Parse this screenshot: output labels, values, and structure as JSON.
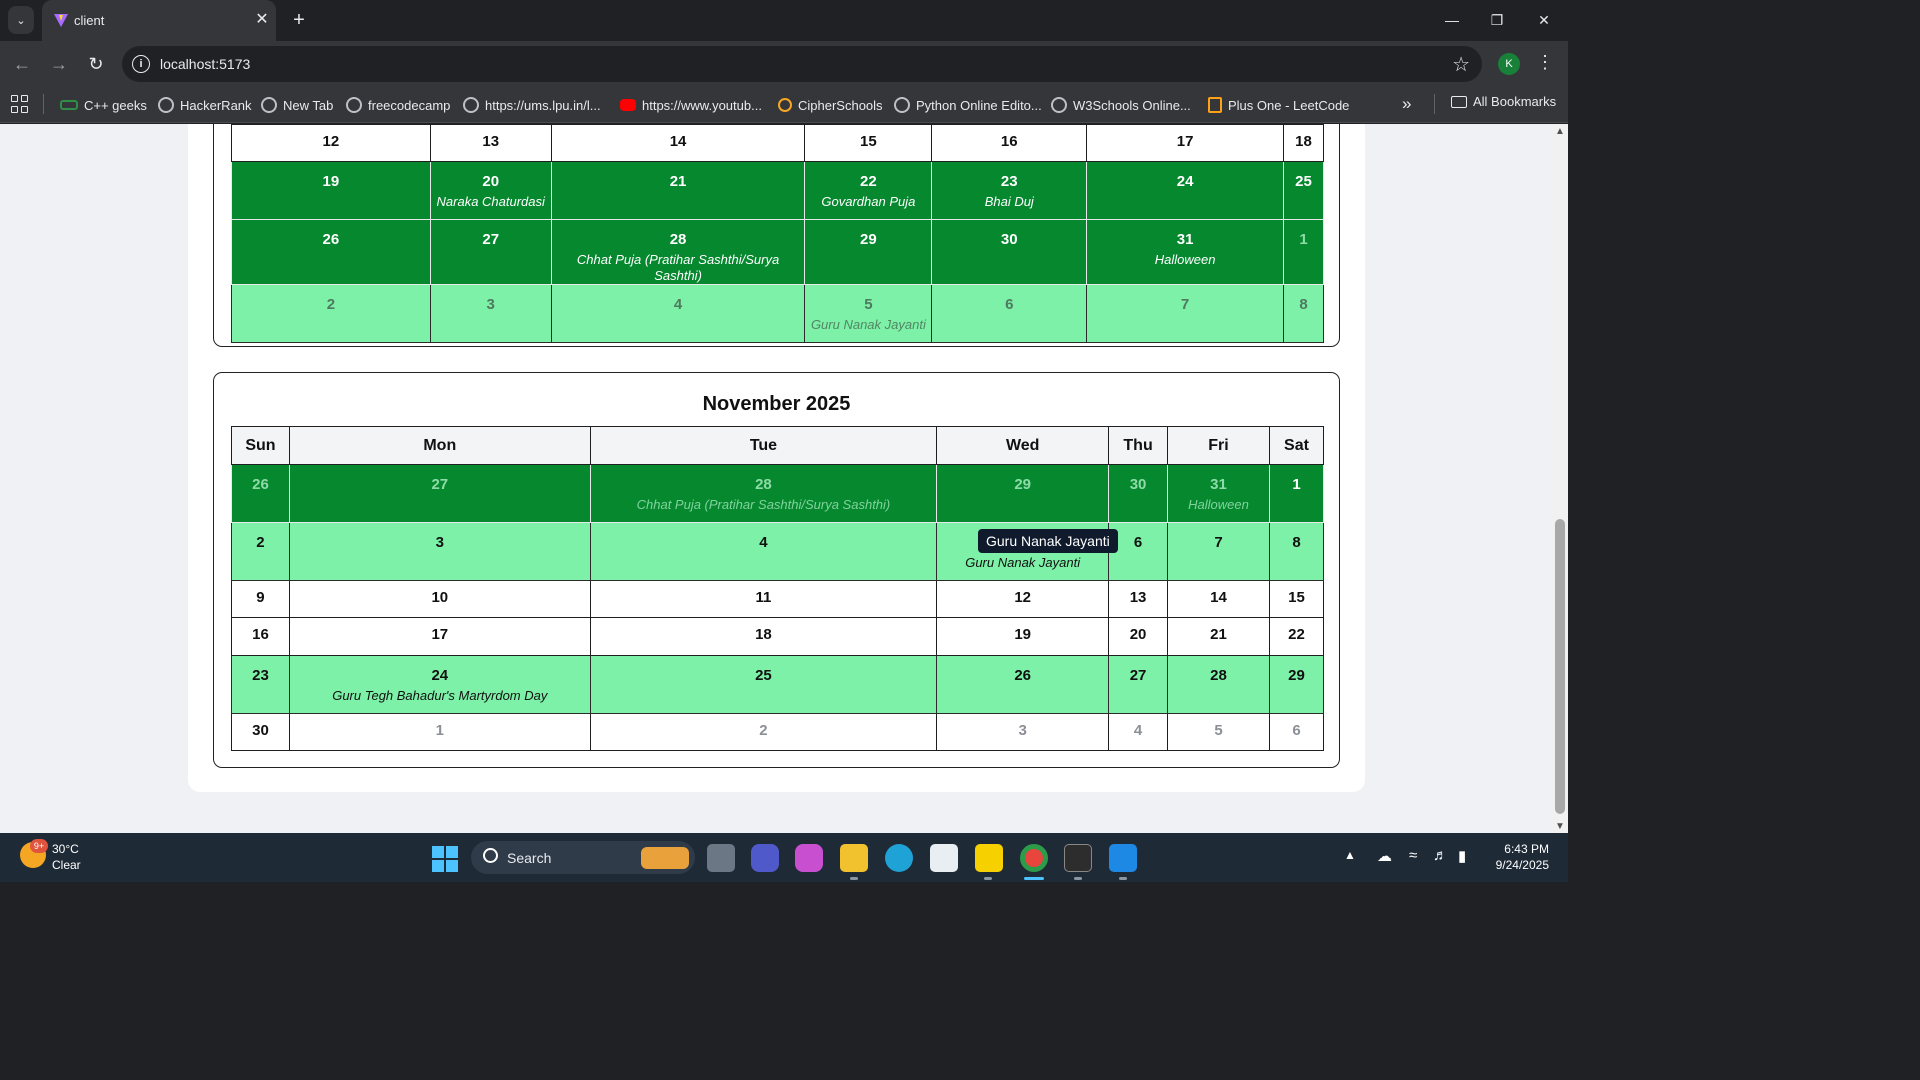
{
  "browser": {
    "tab_title": "client",
    "url": "localhost:5173",
    "profile_initial": "K",
    "bookmarks": [
      "C++ geeks",
      "HackerRank",
      "New Tab",
      "freecodecamp",
      "https://ums.lpu.in/l...",
      "https://www.youtub...",
      "CipherSchools",
      "Python Online Edito...",
      "W3Schools Online...",
      "Plus One - LeetCode"
    ],
    "all_bookmarks_label": "All Bookmarks"
  },
  "weekday_headers": [
    "Sun",
    "Mon",
    "Tue",
    "Wed",
    "Thu",
    "Fri",
    "Sat"
  ],
  "october": {
    "rows": [
      {
        "style": "white",
        "cells": [
          {
            "day": "12"
          },
          {
            "day": "13"
          },
          {
            "day": "14"
          },
          {
            "day": "15"
          },
          {
            "day": "16"
          },
          {
            "day": "17"
          },
          {
            "day": "18"
          }
        ]
      },
      {
        "style": "dark",
        "cells": [
          {
            "day": "19"
          },
          {
            "day": "20",
            "holiday": "Naraka Chaturdasi"
          },
          {
            "day": "21"
          },
          {
            "day": "22",
            "holiday": "Govardhan Puja"
          },
          {
            "day": "23",
            "holiday": "Bhai Duj"
          },
          {
            "day": "24"
          },
          {
            "day": "25"
          }
        ]
      },
      {
        "style": "dark",
        "cells": [
          {
            "day": "26"
          },
          {
            "day": "27"
          },
          {
            "day": "28",
            "holiday": "Chhat Puja (Pratihar Sashthi/Surya Sashthi)"
          },
          {
            "day": "29"
          },
          {
            "day": "30"
          },
          {
            "day": "31",
            "holiday": "Halloween"
          },
          {
            "day": "1",
            "other": true
          }
        ]
      },
      {
        "style": "light",
        "cells": [
          {
            "day": "2",
            "other": true
          },
          {
            "day": "3",
            "other": true
          },
          {
            "day": "4",
            "other": true
          },
          {
            "day": "5",
            "other": true,
            "holiday": "Guru Nanak Jayanti"
          },
          {
            "day": "6",
            "other": true
          },
          {
            "day": "7",
            "other": true
          },
          {
            "day": "8",
            "other": true
          }
        ]
      }
    ]
  },
  "november": {
    "title": "November 2025",
    "rows": [
      {
        "style": "dark",
        "cells": [
          {
            "day": "26",
            "other": true
          },
          {
            "day": "27",
            "other": true
          },
          {
            "day": "28",
            "other": true,
            "holiday": "Chhat Puja (Pratihar Sashthi/Surya Sashthi)"
          },
          {
            "day": "29",
            "other": true
          },
          {
            "day": "30",
            "other": true
          },
          {
            "day": "31",
            "other": true,
            "holiday": "Halloween"
          },
          {
            "day": "1"
          }
        ]
      },
      {
        "style": "light",
        "cells": [
          {
            "day": "2"
          },
          {
            "day": "3"
          },
          {
            "day": "4"
          },
          {
            "day": "5",
            "holiday": "Guru Nanak Jayanti"
          },
          {
            "day": "6"
          },
          {
            "day": "7"
          },
          {
            "day": "8"
          }
        ]
      },
      {
        "style": "white",
        "cells": [
          {
            "day": "9"
          },
          {
            "day": "10"
          },
          {
            "day": "11"
          },
          {
            "day": "12"
          },
          {
            "day": "13"
          },
          {
            "day": "14"
          },
          {
            "day": "15"
          }
        ]
      },
      {
        "style": "white",
        "cells": [
          {
            "day": "16"
          },
          {
            "day": "17"
          },
          {
            "day": "18"
          },
          {
            "day": "19"
          },
          {
            "day": "20"
          },
          {
            "day": "21"
          },
          {
            "day": "22"
          }
        ]
      },
      {
        "style": "light",
        "cells": [
          {
            "day": "23"
          },
          {
            "day": "24",
            "holiday": "Guru Tegh Bahadur's Martyrdom Day"
          },
          {
            "day": "25"
          },
          {
            "day": "26"
          },
          {
            "day": "27"
          },
          {
            "day": "28"
          },
          {
            "day": "29"
          }
        ]
      },
      {
        "style": "white",
        "cells": [
          {
            "day": "30"
          },
          {
            "day": "1",
            "other": true
          },
          {
            "day": "2",
            "other": true
          },
          {
            "day": "3",
            "other": true
          },
          {
            "day": "4",
            "other": true
          },
          {
            "day": "5",
            "other": true
          },
          {
            "day": "6",
            "other": true
          }
        ]
      }
    ]
  },
  "tooltip": "Guru Nanak Jayanti",
  "taskbar": {
    "weather_badge": "9+",
    "temperature": "30°C",
    "condition": "Clear",
    "search_label": "Search",
    "time": "6:43 PM",
    "date": "9/24/2025"
  },
  "colors": {
    "dark_green": "#06882f",
    "light_green": "#7cf1a7",
    "taskbar": "#1f2a37"
  }
}
